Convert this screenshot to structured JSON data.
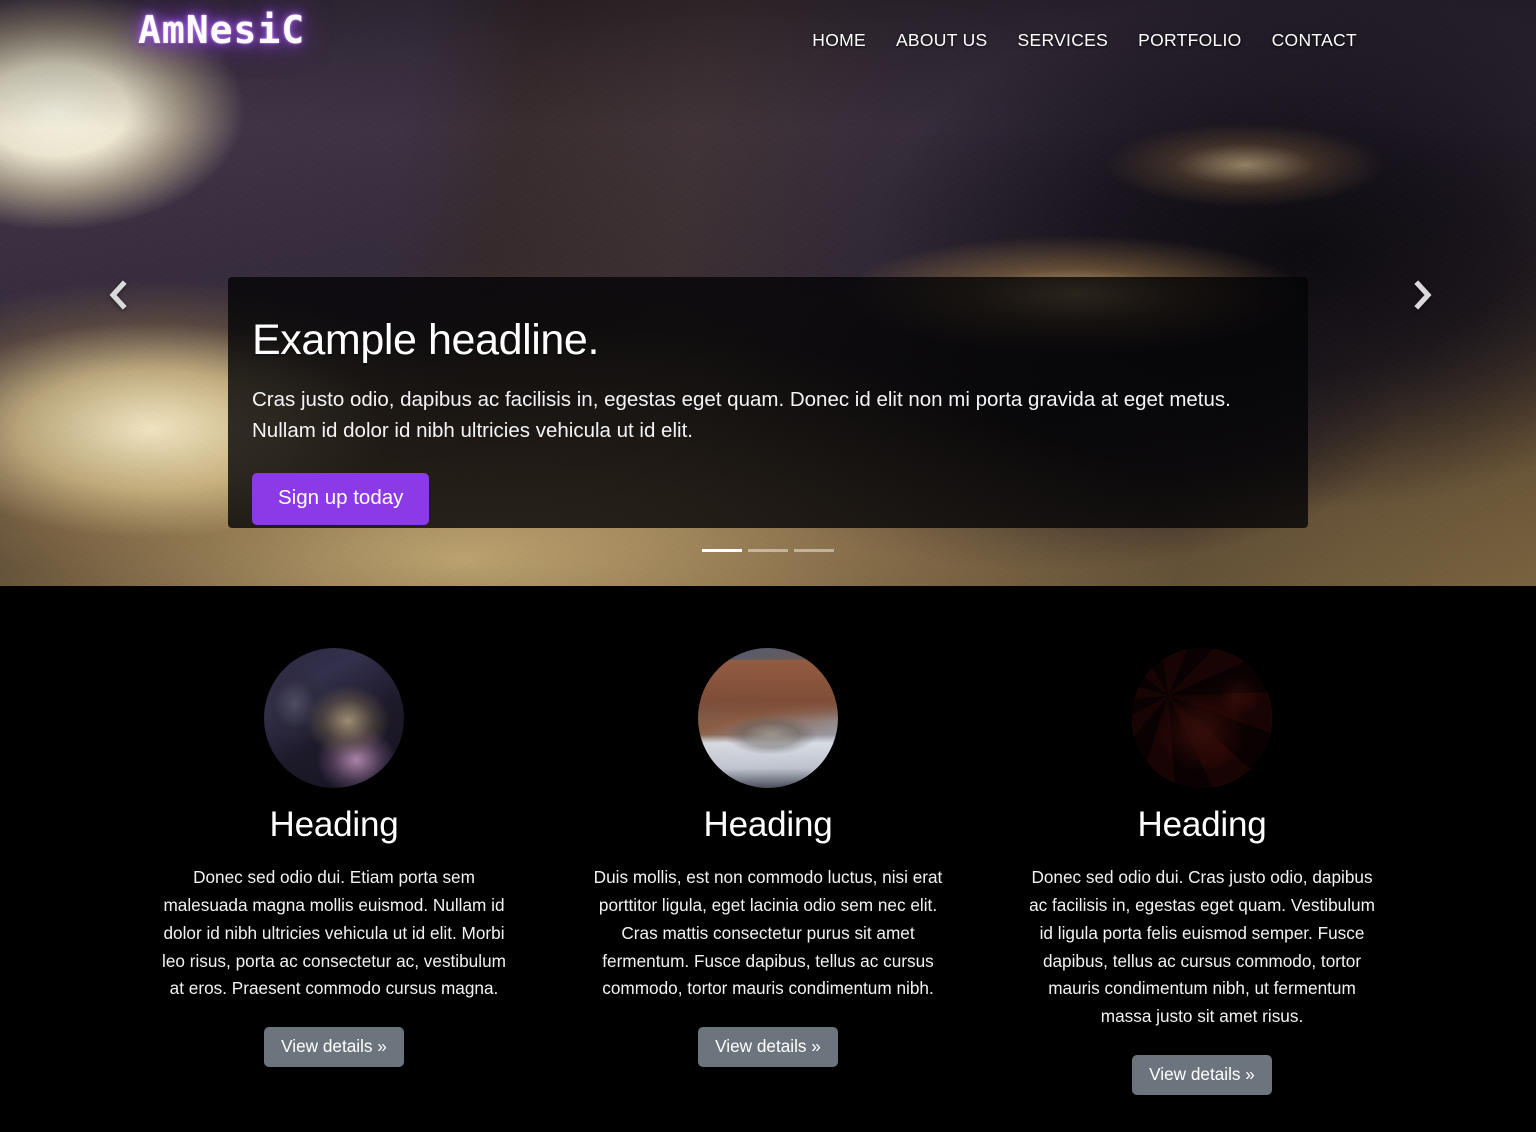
{
  "site": {
    "brand": "AmNesiC",
    "brand_glow_color": "#8a3fd6"
  },
  "header": {
    "nav": [
      {
        "label": "HOME",
        "name": "nav-home"
      },
      {
        "label": "ABOUT US",
        "name": "nav-about-us"
      },
      {
        "label": "SERVICES",
        "name": "nav-services"
      },
      {
        "label": "PORTFOLIO",
        "name": "nav-portfolio"
      },
      {
        "label": "CONTACT",
        "name": "nav-contact"
      }
    ]
  },
  "hero": {
    "caption": {
      "title": "Example headline.",
      "text": "Cras justo odio, dapibus ac facilisis in, egestas eget quam. Donec id elit non mi porta gravida at eget metus. Nullam id dolor id nibh ultricies vehicula ut id elit.",
      "cta_label": "Sign up today",
      "cta_color": "#8c3ae8"
    },
    "controls": {
      "prev_icon": "chevron-left-icon",
      "next_icon": "chevron-right-icon"
    },
    "indicators": {
      "count": 3,
      "active_index": 0
    },
    "slide_image_alt": "backlit cat lying on sunlit carpet"
  },
  "features": {
    "columns": [
      {
        "image_alt": "tabby cat resting on purple blanket",
        "heading": "Heading",
        "text": "Donec sed odio dui. Etiam porta sem malesuada magna mollis euismod. Nullam id dolor id nibh ultricies vehicula ut id elit. Morbi leo risus, porta ac consectetur ac, vestibulum at eros. Praesent commodo cursus magna.",
        "button_label": "View details »"
      },
      {
        "image_alt": "tabby cat lying on a doorstep",
        "heading": "Heading",
        "text": "Duis mollis, est non commodo luctus, nisi erat porttitor ligula, eget lacinia odio sem nec elit. Cras mattis consectetur purus sit amet fermentum. Fusce dapibus, tellus ac cursus commodo, tortor mauris condimentum nibh.",
        "button_label": "View details »"
      },
      {
        "image_alt": "cat under red light with checkerboard backdrop",
        "heading": "Heading",
        "text": "Donec sed odio dui. Cras justo odio, dapibus ac facilisis in, egestas eget quam. Vestibulum id ligula porta felis euismod semper. Fusce dapibus, tellus ac cursus commodo, tortor mauris condimentum nibh, ut fermentum massa justo sit amet risus.",
        "button_label": "View details »"
      }
    ],
    "button_color": "#6c757d"
  }
}
